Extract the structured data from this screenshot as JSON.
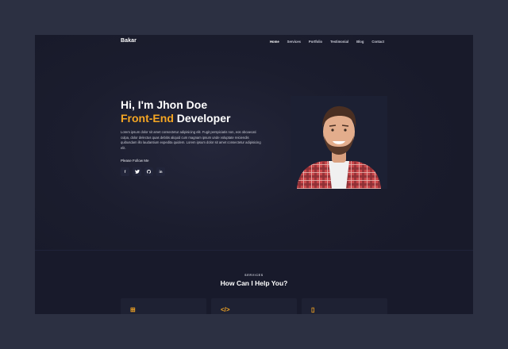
{
  "nav": {
    "logo": "Bakar",
    "items": [
      {
        "label": "Home",
        "active": true
      },
      {
        "label": "Services",
        "active": false
      },
      {
        "label": "Portfolio",
        "active": false
      },
      {
        "label": "Testimonial",
        "active": false
      },
      {
        "label": "Blog",
        "active": false
      },
      {
        "label": "Contact",
        "active": false
      }
    ]
  },
  "hero": {
    "greeting": "Hi, I'm Jhon Doe",
    "role_accent": "Front-End",
    "role_rest": " Developer",
    "description": "Lorem ipsum dolor sit amet consectetur adipisicing elit. Fugit perspiciatis non, eos obcaecati culpa, dolor delectus quas debitis aliquid cum magnam ipsum unde voluptate reiciendis quibusdam illo laudantium expedita quidem. Lorem ipsum dolor sit amet consectetur adipisicing elit.",
    "follow_label": "Please Follow Me",
    "socials": [
      {
        "icon": "facebook-icon",
        "glyph": "f"
      },
      {
        "icon": "twitter-icon",
        "glyph": "♥"
      },
      {
        "icon": "github-icon",
        "glyph": "●"
      },
      {
        "icon": "linkedin-icon",
        "glyph": "in"
      }
    ]
  },
  "services": {
    "eyebrow": "SERVICES",
    "title": "How Can I Help You?",
    "cards": [
      {
        "icon": "layout-icon",
        "glyph": "⊞"
      },
      {
        "icon": "code-icon",
        "glyph": "</>"
      },
      {
        "icon": "mobile-icon",
        "glyph": "▯"
      }
    ]
  },
  "colors": {
    "accent": "#f5a623",
    "background": "#1b1d2e",
    "outer": "#2c3042"
  }
}
